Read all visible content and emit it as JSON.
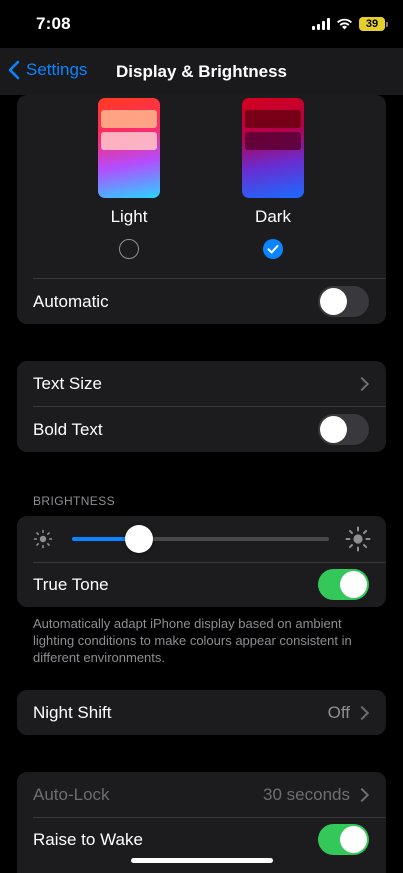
{
  "status_bar": {
    "time": "7:08",
    "battery": "39",
    "battery_color": "#e6cf2a"
  },
  "nav": {
    "back_label": "Settings",
    "title": "Display & Brightness"
  },
  "appearance": {
    "light_label": "Light",
    "dark_label": "Dark",
    "selected": "Dark",
    "automatic_label": "Automatic",
    "automatic_on": false
  },
  "text": {
    "text_size_label": "Text Size",
    "bold_text_label": "Bold Text",
    "bold_text_on": false
  },
  "brightness": {
    "header": "BRIGHTNESS",
    "level": 0.26,
    "true_tone_label": "True Tone",
    "true_tone_on": true,
    "footer": "Automatically adapt iPhone display based on ambient lighting conditions to make colours appear consistent in different environments."
  },
  "night_shift": {
    "label": "Night Shift",
    "value": "Off"
  },
  "lock": {
    "auto_lock_label": "Auto-Lock",
    "auto_lock_value": "30 seconds",
    "raise_to_wake_label": "Raise to Wake",
    "raise_to_wake_on": true
  },
  "colors": {
    "accent": "#0a84ff",
    "toggle_on": "#34c759",
    "card": "#1c1c1e"
  }
}
